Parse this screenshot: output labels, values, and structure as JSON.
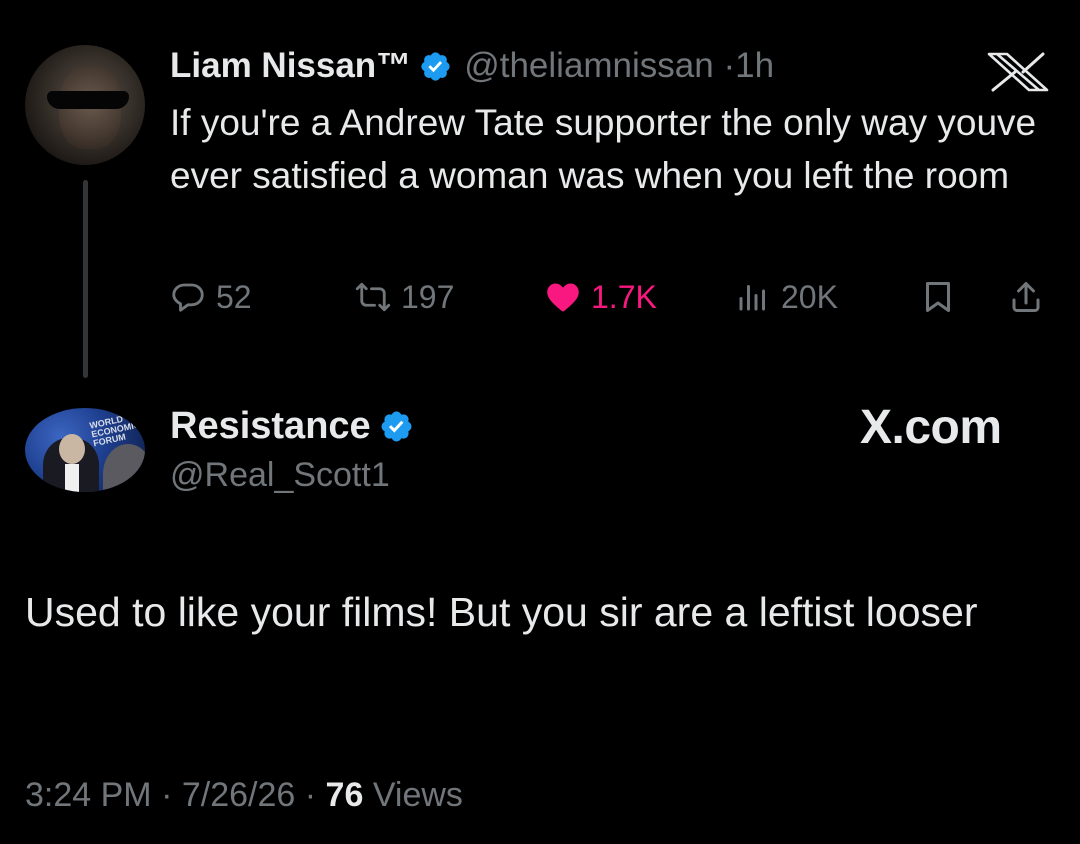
{
  "parent_tweet": {
    "author_name": "Liam Nissan™",
    "handle": "@theliamnissan",
    "separator": "·",
    "time_ago": "1h",
    "text": "If you're a Andrew Tate supporter the only way youve ever satisfied a woman was when you left the room",
    "replies": "52",
    "retweets": "197",
    "likes": "1.7K",
    "views": "20K"
  },
  "reply_tweet": {
    "author_name": "Resistance",
    "handle": "@Real_Scott1",
    "avatar_text": "WORLD ECONOMIC FORUM",
    "text": "Used to like your films! But you sir are a leftist looser",
    "time": "3:24 PM",
    "date": "7/26/26",
    "view_count": "76",
    "views_label": "Views",
    "sep": "·"
  },
  "watermark": "X.com",
  "colors": {
    "background": "#000000",
    "text": "#e7e9ea",
    "muted": "#71767b",
    "verified": "#1d9bf0",
    "like": "#f91880"
  },
  "icons": [
    "verified-badge-icon",
    "x-logo-icon",
    "reply-icon",
    "retweet-icon",
    "heart-icon",
    "views-icon",
    "bookmark-icon",
    "share-icon"
  ]
}
